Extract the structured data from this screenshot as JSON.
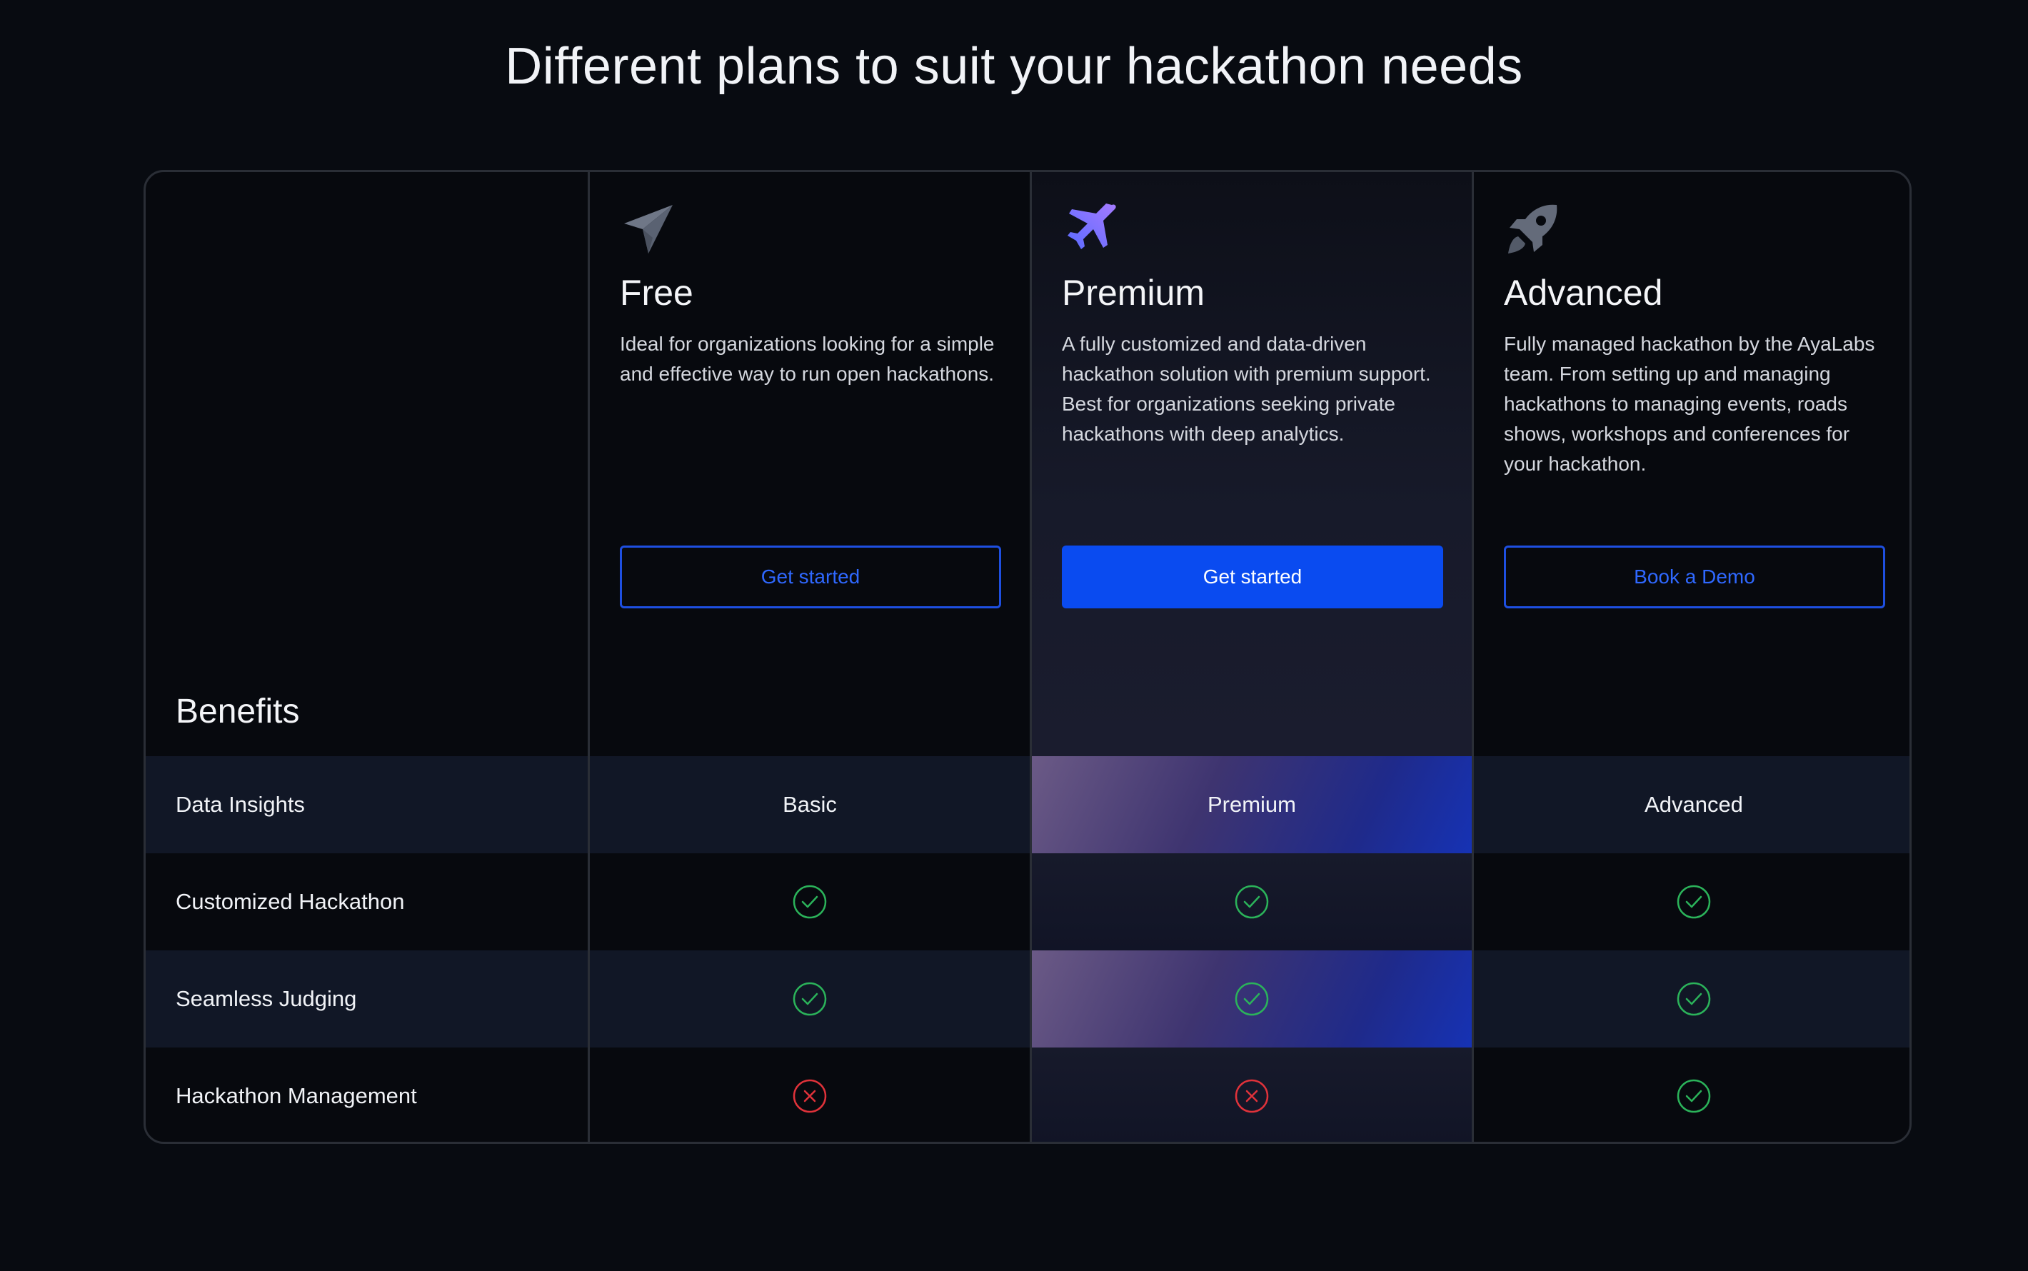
{
  "page_title": "Different plans to suit your hackathon needs",
  "benefits_header": "Benefits",
  "plans": [
    {
      "name": "Free",
      "icon": "paper-plane-icon",
      "description": "Ideal for organizations looking for a simple and effective way to run open hackathons.",
      "button_label": "Get started",
      "button_style": "outline"
    },
    {
      "name": "Premium",
      "icon": "airplane-icon",
      "description": "A fully customized and data-driven hackathon solution with premium support. Best for organizations seeking private hackathons with deep analytics.",
      "button_label": "Get started",
      "button_style": "solid"
    },
    {
      "name": "Advanced",
      "icon": "rocket-icon",
      "description": "Fully managed hackathon by the AyaLabs team. From setting up and managing hackathons to managing events, roads shows, workshops and conferences for your hackathon.",
      "button_label": "Book a Demo",
      "button_style": "outline"
    }
  ],
  "benefits": [
    {
      "label": "Data Insights",
      "free": "Basic",
      "premium": "Premium",
      "advanced": "Advanced"
    },
    {
      "label": "Customized Hackathon",
      "free": "check",
      "premium": "check",
      "advanced": "check"
    },
    {
      "label": "Seamless Judging",
      "free": "check",
      "premium": "check",
      "advanced": "check"
    },
    {
      "label": "Hackathon Management",
      "free": "cross",
      "premium": "cross",
      "advanced": "check"
    }
  ],
  "colors": {
    "background": "#080b11",
    "accent_blue": "#0a4bf0",
    "check_green": "#2bb35a",
    "cross_red": "#e0323a",
    "premium_icon": "#7b6cff"
  }
}
